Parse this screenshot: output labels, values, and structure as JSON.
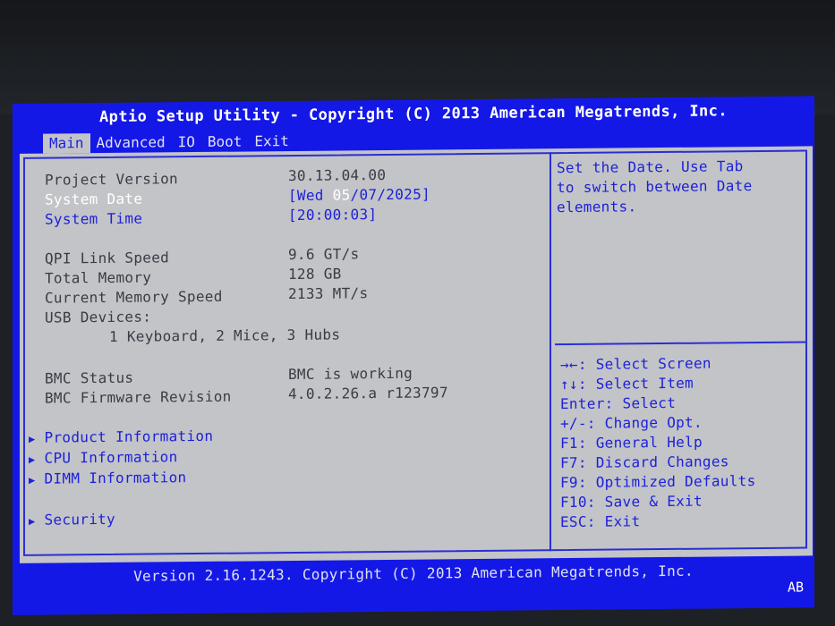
{
  "header": {
    "title": "Aptio Setup Utility - Copyright (C) 2013 American Megatrends, Inc."
  },
  "tabs": [
    {
      "label": "Main",
      "active": true
    },
    {
      "label": "Advanced",
      "active": false
    },
    {
      "label": "IO",
      "active": false
    },
    {
      "label": "Boot",
      "active": false
    },
    {
      "label": "Exit",
      "active": false
    }
  ],
  "main": {
    "project_version": {
      "label": "Project Version",
      "value": "30.13.04.00"
    },
    "system_date": {
      "label": "System Date",
      "prefix": "[Wed ",
      "month": "05",
      "rest": "/07/2025]"
    },
    "system_time": {
      "label": "System Time",
      "value": "[20:00:03]"
    },
    "qpi": {
      "label": "QPI Link Speed",
      "value": "9.6 GT/s"
    },
    "total_memory": {
      "label": "Total Memory",
      "value": "128 GB"
    },
    "memory_speed": {
      "label": "Current Memory Speed",
      "value": "2133 MT/s"
    },
    "usb": {
      "label": "USB Devices:",
      "value": "1 Keyboard, 2 Mice, 3 Hubs"
    },
    "bmc_status": {
      "label": "BMC Status",
      "value": "BMC is working"
    },
    "bmc_fw": {
      "label": "BMC Firmware Revision",
      "value": "4.0.2.26.a r123797"
    },
    "submenus": [
      {
        "label": "Product Information"
      },
      {
        "label": "CPU Information"
      },
      {
        "label": "DIMM Information"
      },
      {
        "label": "Security"
      }
    ]
  },
  "help": {
    "lines": [
      "Set the Date. Use Tab",
      "to switch between Date",
      "elements."
    ]
  },
  "keys": [
    "→←: Select Screen",
    "↑↓: Select Item",
    "Enter: Select",
    "+/-: Change Opt.",
    "F1: General Help",
    "F7: Discard Changes",
    "F9: Optimized Defaults",
    "F10: Save & Exit",
    "ESC: Exit"
  ],
  "footer": {
    "text": "Version 2.16.1243. Copyright (C) 2013 American Megatrends, Inc.",
    "badge": "AB"
  },
  "colors": {
    "bios_blue": "#1418e6",
    "panel_gray": "#c3c4c8",
    "highlight_text": "#ffffff"
  }
}
